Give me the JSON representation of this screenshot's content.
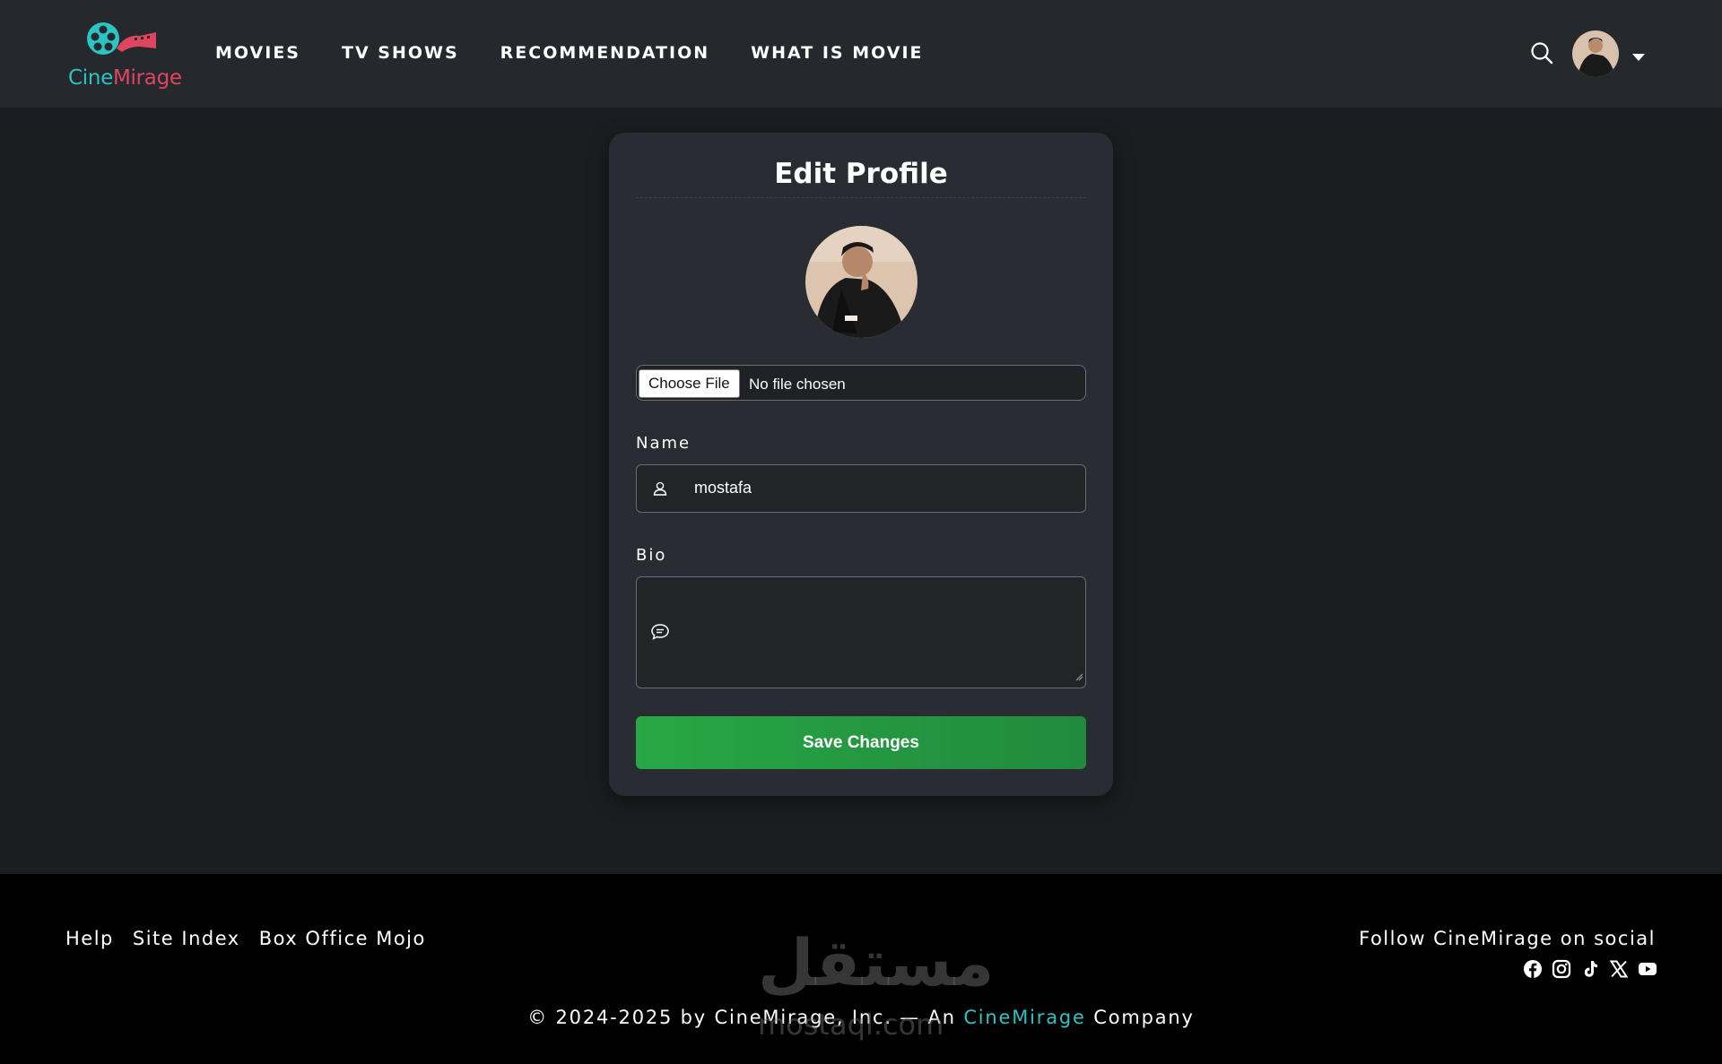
{
  "brand": {
    "name_part1": "Cine",
    "name_part2": "Mirage",
    "primary_color": "#2cc3c3",
    "secondary_color": "#e04560"
  },
  "nav": {
    "items": [
      {
        "label": "MOVIES"
      },
      {
        "label": "TV SHOWS"
      },
      {
        "label": "RECOMMENDATION"
      },
      {
        "label": "WHAT IS MOVIE"
      }
    ]
  },
  "header": {
    "search_icon": "search-icon",
    "avatar_icon": "user-avatar",
    "dropdown_icon": "caret-down-icon"
  },
  "edit_profile": {
    "title": "Edit Profile",
    "file_input": {
      "button_label": "Choose File",
      "status": "No file chosen"
    },
    "name_field": {
      "label": "Name",
      "value": "mostafa",
      "icon": "user-icon"
    },
    "bio_field": {
      "label": "Bio",
      "value": "",
      "icon": "comment-icon"
    },
    "save_label": "Save Changes",
    "save_color": "#28a745"
  },
  "footer": {
    "links": [
      {
        "label": "Help"
      },
      {
        "label": "Site Index"
      },
      {
        "label": "Box Office Mojo"
      }
    ],
    "social_title": "Follow CineMirage on social",
    "social_icons": [
      "facebook-icon",
      "instagram-icon",
      "tiktok-icon",
      "x-icon",
      "youtube-icon"
    ],
    "copyright_prefix": "© 2024-2025 by CineMirage, Inc. — An",
    "copyright_brand": "CineMirage",
    "copyright_suffix": "Company"
  },
  "watermark": {
    "arabic": "مستقل",
    "latin": "mostaql.com"
  }
}
